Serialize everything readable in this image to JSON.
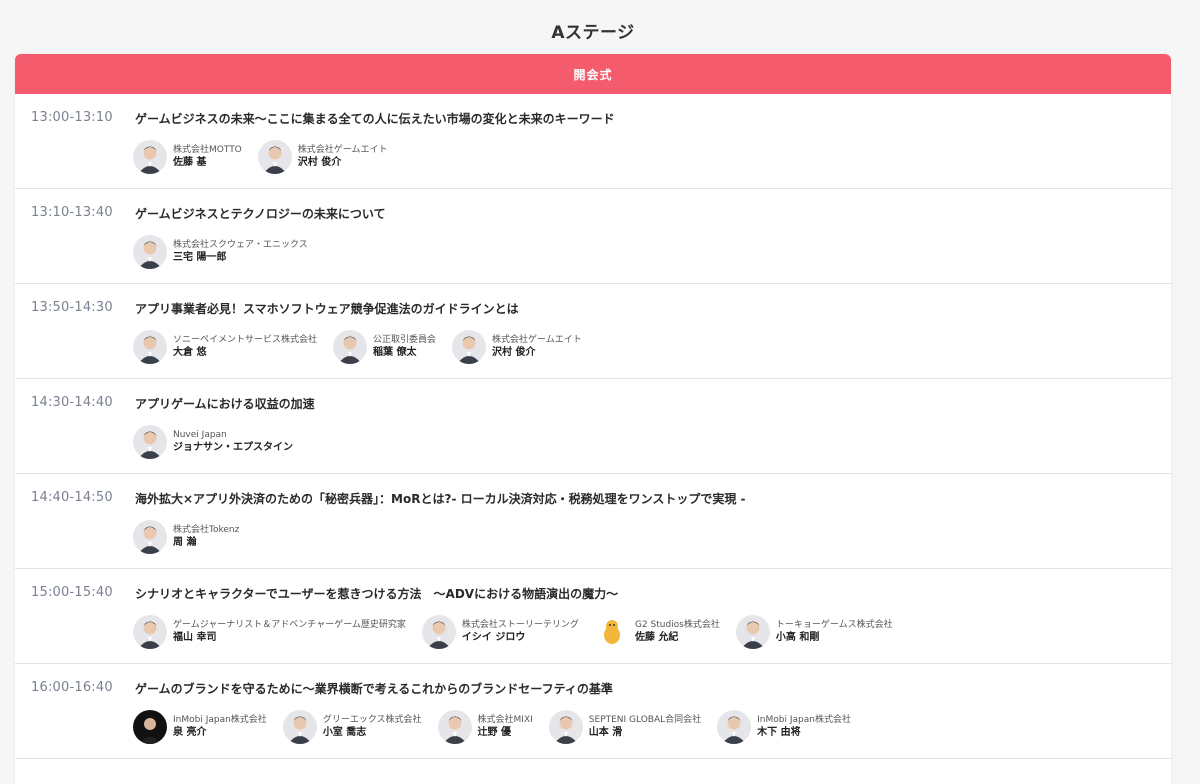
{
  "stage_title": "Aステージ",
  "opening_label": "開会式",
  "sessions": [
    {
      "time": "13:00-13:10",
      "title": "ゲームビジネスの未来〜ここに集まる全ての人に伝えたい市場の変化と未来のキーワード",
      "speakers": [
        {
          "org": "株式会社MOTTO",
          "name": "佐藤 基"
        },
        {
          "org": "株式会社ゲームエイト",
          "name": "沢村 俊介"
        }
      ]
    },
    {
      "time": "13:10-13:40",
      "title": "ゲームビジネスとテクノロジーの未来について",
      "speakers": [
        {
          "org": "株式会社スクウェア・エニックス",
          "name": "三宅 陽一郎"
        }
      ]
    },
    {
      "time": "13:50-14:30",
      "title": "アプリ事業者必見！スマホソフトウェア競争促進法のガイドラインとは",
      "speakers": [
        {
          "org": "ソニーペイメントサービス株式会社",
          "name": "大倉 悠"
        },
        {
          "org": "公正取引委員会",
          "name": "稲葉 僚太"
        },
        {
          "org": "株式会社ゲームエイト",
          "name": "沢村 俊介"
        }
      ]
    },
    {
      "time": "14:30-14:40",
      "title": "アプリゲームにおける収益の加速",
      "speakers": [
        {
          "org": "Nuvei Japan",
          "name": "ジョナサン・エプスタイン"
        }
      ]
    },
    {
      "time": "14:40-14:50",
      "title": "海外拡大×アプリ外決済のための「秘密兵器」：MoRとは?- ローカル決済対応・税務処理をワンストップで実現 -",
      "speakers": [
        {
          "org": "株式会社Tokenz",
          "name": "周 瀚"
        }
      ]
    },
    {
      "time": "15:00-15:40",
      "title": "シナリオとキャラクターでユーザーを惹きつける方法　〜ADVにおける物語演出の魔力〜",
      "speakers": [
        {
          "org": "ゲームジャーナリスト＆アドベンチャーゲーム歴史研究家",
          "name": "福山 幸司"
        },
        {
          "org": "株式会社ストーリーテリング",
          "name": "イシイ ジロウ"
        },
        {
          "org": "G2 Studios株式会社",
          "name": "佐藤 允紀"
        },
        {
          "org": "トーキョーゲームス株式会社",
          "name": "小高 和剛"
        }
      ]
    },
    {
      "time": "16:00-16:40",
      "title": "ゲームのブランドを守るために〜業界横断で考えるこれからのブランドセーフティの基準",
      "speakers": [
        {
          "org": "InMobi Japan株式会社",
          "name": "泉 亮介"
        },
        {
          "org": "グリーエックス株式会社",
          "name": "小室 喬志"
        },
        {
          "org": "株式会社MIXI",
          "name": "辻野 優"
        },
        {
          "org": "SEPTENI GLOBAL合同会社",
          "name": "山本 滑"
        },
        {
          "org": "InMobi Japan株式会社",
          "name": "木下 由将"
        }
      ]
    }
  ],
  "avatar_colors": {
    "skin": "#e8c9b0",
    "hair": "#2b2b2b",
    "suit": "#3a3f4a",
    "bg": "#e6e6ea",
    "mascot": "#f2b63a"
  }
}
